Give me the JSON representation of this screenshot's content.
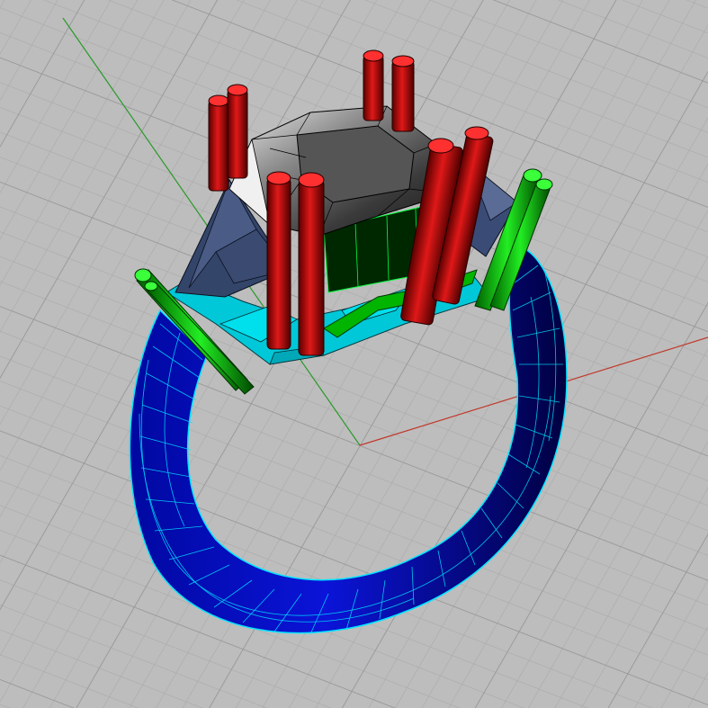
{
  "viewport": {
    "background": "#bdbdbd",
    "grid_minor_color": "#a9a9a9",
    "grid_major_color": "#959595",
    "axis_x_color": "#c0392b",
    "axis_y_color": "#2a9a2a"
  },
  "model": {
    "shank_color": "#0b14d8",
    "shank_wire_color": "#00e5ff",
    "gallery_color": "#00c8d8",
    "basket_color": "#00b400",
    "side_plate_color": "#34456a",
    "stone_color": "#4a4a4a",
    "prong_color": "#c01010",
    "side_prong_color": "#14d414"
  }
}
